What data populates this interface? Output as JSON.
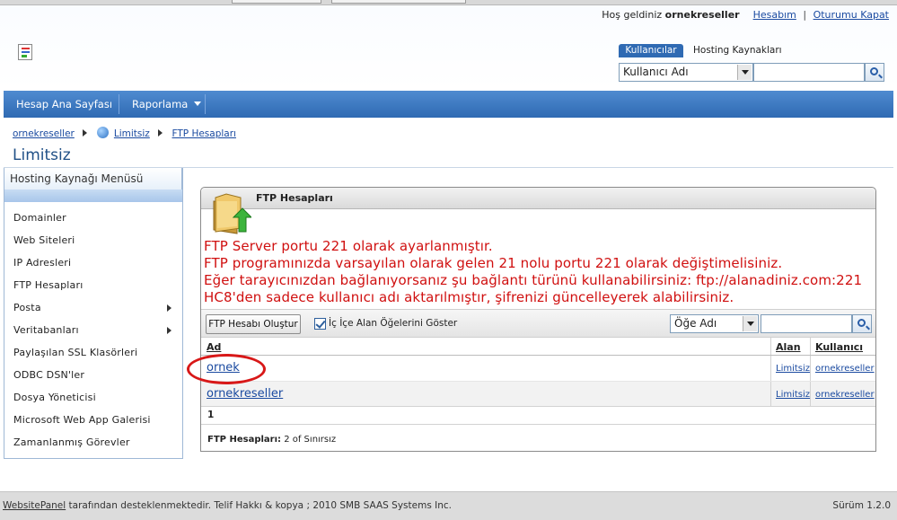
{
  "header": {
    "welcome_text": "Hoş geldiniz",
    "username": "ornekreseller",
    "account_link": "Hesabım",
    "separator": "|",
    "logout_link": "Oturumu Kapat"
  },
  "search": {
    "tab_active": "Kullanıcılar",
    "tab_other": "Hosting Kaynakları",
    "select_value": "Kullanıcı Adı",
    "input_value": ""
  },
  "nav": {
    "items": [
      "Hesap Ana Sayfası",
      "Raporlama"
    ]
  },
  "breadcrumb": {
    "items": [
      "ornekreseller",
      "Limitsiz",
      "FTP Hesapları"
    ]
  },
  "page_title": "Limitsiz",
  "sidebar": {
    "title": "Hosting Kaynağı Menüsü",
    "items": [
      {
        "label": "Domainler",
        "submenu": false
      },
      {
        "label": "Web Siteleri",
        "submenu": false
      },
      {
        "label": "IP Adresleri",
        "submenu": false
      },
      {
        "label": "FTP Hesapları",
        "submenu": false
      },
      {
        "label": "Posta",
        "submenu": true
      },
      {
        "label": "Veritabanları",
        "submenu": true
      },
      {
        "label": "Paylaşılan SSL Klasörleri",
        "submenu": false
      },
      {
        "label": "ODBC DSN'ler",
        "submenu": false
      },
      {
        "label": "Dosya Yöneticisi",
        "submenu": false
      },
      {
        "label": "Microsoft Web App Galerisi",
        "submenu": false
      },
      {
        "label": "Zamanlanmış Görevler",
        "submenu": false
      }
    ]
  },
  "panel": {
    "title": "FTP Hesapları",
    "notice_lines": [
      "FTP Server portu 221 olarak ayarlanmıştır.",
      "FTP programınızda varsayılan olarak gelen 21 nolu portu 221 olarak değiştimelisiniz.",
      "Eğer tarayıcınızdan bağlanıyorsanız şu bağlantı türünü kullanabilirsiniz: ftp://alanadiniz.com:221",
      "HC8'den sadece kullanıcı adı aktarılmıştır, şifrenizi güncelleyerek alabilirsiniz."
    ],
    "create_button": "FTP Hesabı Oluştur",
    "checkbox_label": "İç İçe Alan Öğelerini Göster",
    "checkbox_checked": true,
    "filter_select": "Öğe Adı",
    "filter_input": "",
    "columns": [
      "Ad",
      "Alan",
      "Kullanıcı"
    ],
    "rows": [
      {
        "name": "ornek",
        "space": "Limitsiz",
        "user": "ornekreseller"
      },
      {
        "name": "ornekreseller",
        "space": "Limitsiz",
        "user": "ornekreseller"
      }
    ],
    "page_number": "1",
    "count_label": "FTP Hesapları:",
    "count_value": "2 of Sınırsız"
  },
  "footer": {
    "brand_link": "WebsitePanel",
    "left_text": " tarafından desteklenmektedir. Telif Hakkı & kopya ; 2010 SMB SAAS Systems Inc.",
    "version": "Sürüm 1.2.0"
  },
  "colors": {
    "nav_bg": "#2f6ab3",
    "link": "#1a4aa0",
    "notice": "#d01010",
    "highlight_ellipse": "#d81818"
  }
}
